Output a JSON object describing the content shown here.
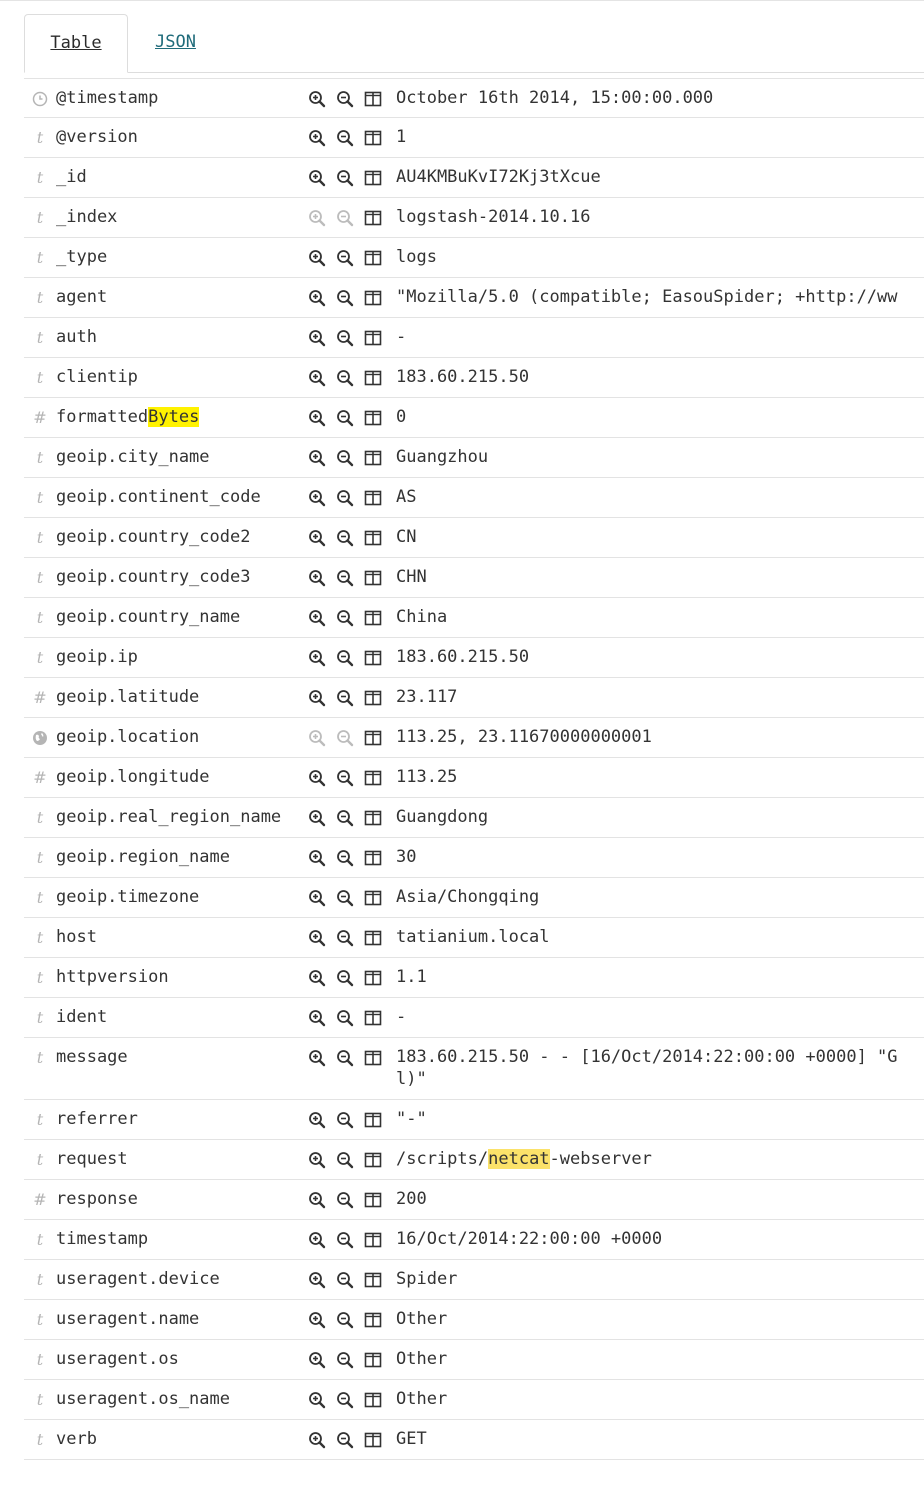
{
  "tabs": [
    {
      "label": "Table",
      "active": true
    },
    {
      "label": "JSON",
      "active": false
    }
  ],
  "fields": [
    {
      "type": "date",
      "name": "@timestamp",
      "value": "October 16th 2014, 15:00:00.000"
    },
    {
      "type": "string",
      "name": "@version",
      "value": "1"
    },
    {
      "type": "string",
      "name": "_id",
      "value": "AU4KMBuKvI72Kj3tXcue"
    },
    {
      "type": "string",
      "name": "_index",
      "value": "logstash-2014.10.16",
      "filters_disabled": true
    },
    {
      "type": "string",
      "name": "_type",
      "value": "logs"
    },
    {
      "type": "string",
      "name": "agent",
      "value": "\"Mozilla/5.0 (compatible; EasouSpider; +http://ww"
    },
    {
      "type": "string",
      "name": "auth",
      "value": "-"
    },
    {
      "type": "string",
      "name": "clientip",
      "value": "183.60.215.50"
    },
    {
      "type": "number",
      "name": "formatted",
      "name_highlight": "Bytes",
      "value": "0"
    },
    {
      "type": "string",
      "name": "geoip.city_name",
      "value": "Guangzhou"
    },
    {
      "type": "string",
      "name": "geoip.continent_code",
      "value": "AS"
    },
    {
      "type": "string",
      "name": "geoip.country_code2",
      "value": "CN"
    },
    {
      "type": "string",
      "name": "geoip.country_code3",
      "value": "CHN"
    },
    {
      "type": "string",
      "name": "geoip.country_name",
      "value": "China"
    },
    {
      "type": "string",
      "name": "geoip.ip",
      "value": "183.60.215.50"
    },
    {
      "type": "number",
      "name": "geoip.latitude",
      "value": "23.117"
    },
    {
      "type": "geo",
      "name": "geoip.location",
      "value": "113.25, 23.11670000000001",
      "filters_disabled": true
    },
    {
      "type": "number",
      "name": "geoip.longitude",
      "value": "113.25"
    },
    {
      "type": "string",
      "name": "geoip.real_region_name",
      "value": "Guangdong"
    },
    {
      "type": "string",
      "name": "geoip.region_name",
      "value": "30"
    },
    {
      "type": "string",
      "name": "geoip.timezone",
      "value": "Asia/Chongqing"
    },
    {
      "type": "string",
      "name": "host",
      "value": "tatianium.local"
    },
    {
      "type": "string",
      "name": "httpversion",
      "value": "1.1"
    },
    {
      "type": "string",
      "name": "ident",
      "value": "-"
    },
    {
      "type": "string",
      "name": "message",
      "value": "183.60.215.50 - - [16/Oct/2014:22:00:00 +0000] \"G\nl)\"",
      "multiline": true
    },
    {
      "type": "string",
      "name": "referrer",
      "value": "\"-\""
    },
    {
      "type": "string",
      "name": "request",
      "value_prefix": "/scripts/",
      "value_highlight": "netcat",
      "value_suffix": "-webserver"
    },
    {
      "type": "number",
      "name": "response",
      "value": "200"
    },
    {
      "type": "string",
      "name": "timestamp",
      "value": "16/Oct/2014:22:00:00 +0000"
    },
    {
      "type": "string",
      "name": "useragent.device",
      "value": "Spider"
    },
    {
      "type": "string",
      "name": "useragent.name",
      "value": "Other"
    },
    {
      "type": "string",
      "name": "useragent.os",
      "value": "Other"
    },
    {
      "type": "string",
      "name": "useragent.os_name",
      "value": "Other"
    },
    {
      "type": "string",
      "name": "verb",
      "value": "GET"
    }
  ],
  "icons": {
    "string": "t-string-type-icon",
    "number": "hash-number-type-icon",
    "date": "clock-date-type-icon",
    "geo": "globe-geo-type-icon",
    "filter_for": "magnify-plus-icon",
    "filter_out": "magnify-minus-icon",
    "toggle_column": "column-toggle-icon"
  },
  "colors": {
    "type_icon": "#b5b5b5",
    "tab_link": "#1f6b7a",
    "highlight_yellow": "#fff200",
    "highlight_amber": "#fbe26a",
    "row_border": "#e3e3e3"
  }
}
